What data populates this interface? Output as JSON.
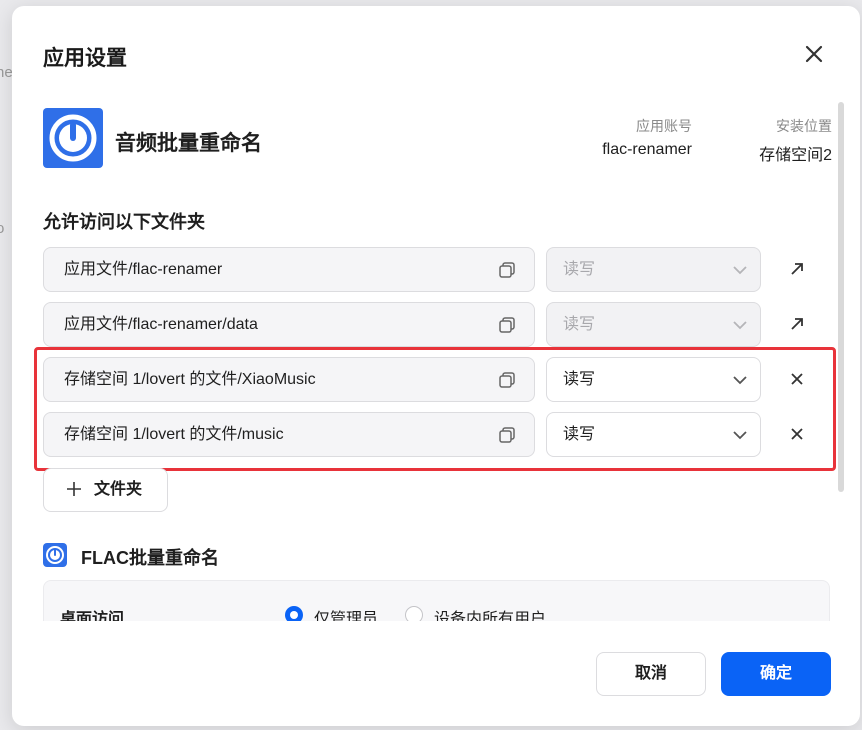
{
  "background": {
    "fragment_1": "ne",
    "fragment_2": "o"
  },
  "dialog": {
    "title": "应用设置"
  },
  "app": {
    "name": "音频批量重命名",
    "account_label": "应用账号",
    "account_value": "flac-renamer",
    "location_label": "安装位置",
    "location_value": "存储空间2",
    "icon": "power-gauge-icon",
    "icon_color": "#2f6fe8"
  },
  "folders": {
    "section_title": "允许访问以下文件夹",
    "rows": [
      {
        "path": "应用文件/flac-renamer",
        "permission": "读写",
        "disabled": true,
        "action": "open-external-icon"
      },
      {
        "path": "应用文件/flac-renamer/data",
        "permission": "读写",
        "disabled": true,
        "action": "open-external-icon"
      },
      {
        "path": "存储空间 1/lovert 的文件/XiaoMusic",
        "permission": "读写",
        "disabled": false,
        "action": "remove-icon"
      },
      {
        "path": "存储空间 1/lovert 的文件/music",
        "permission": "读写",
        "disabled": false,
        "action": "remove-icon"
      }
    ],
    "add_label": "文件夹",
    "highlight_color": "#e8333a"
  },
  "sub_app": {
    "title": "FLAC批量重命名",
    "access_label": "桌面访问",
    "options": [
      {
        "label": "仅管理员",
        "selected": true
      },
      {
        "label": "设备内所有用户",
        "selected": false
      }
    ]
  },
  "footer": {
    "cancel_label": "取消",
    "ok_label": "确定",
    "accent_color": "#0a63f6"
  }
}
